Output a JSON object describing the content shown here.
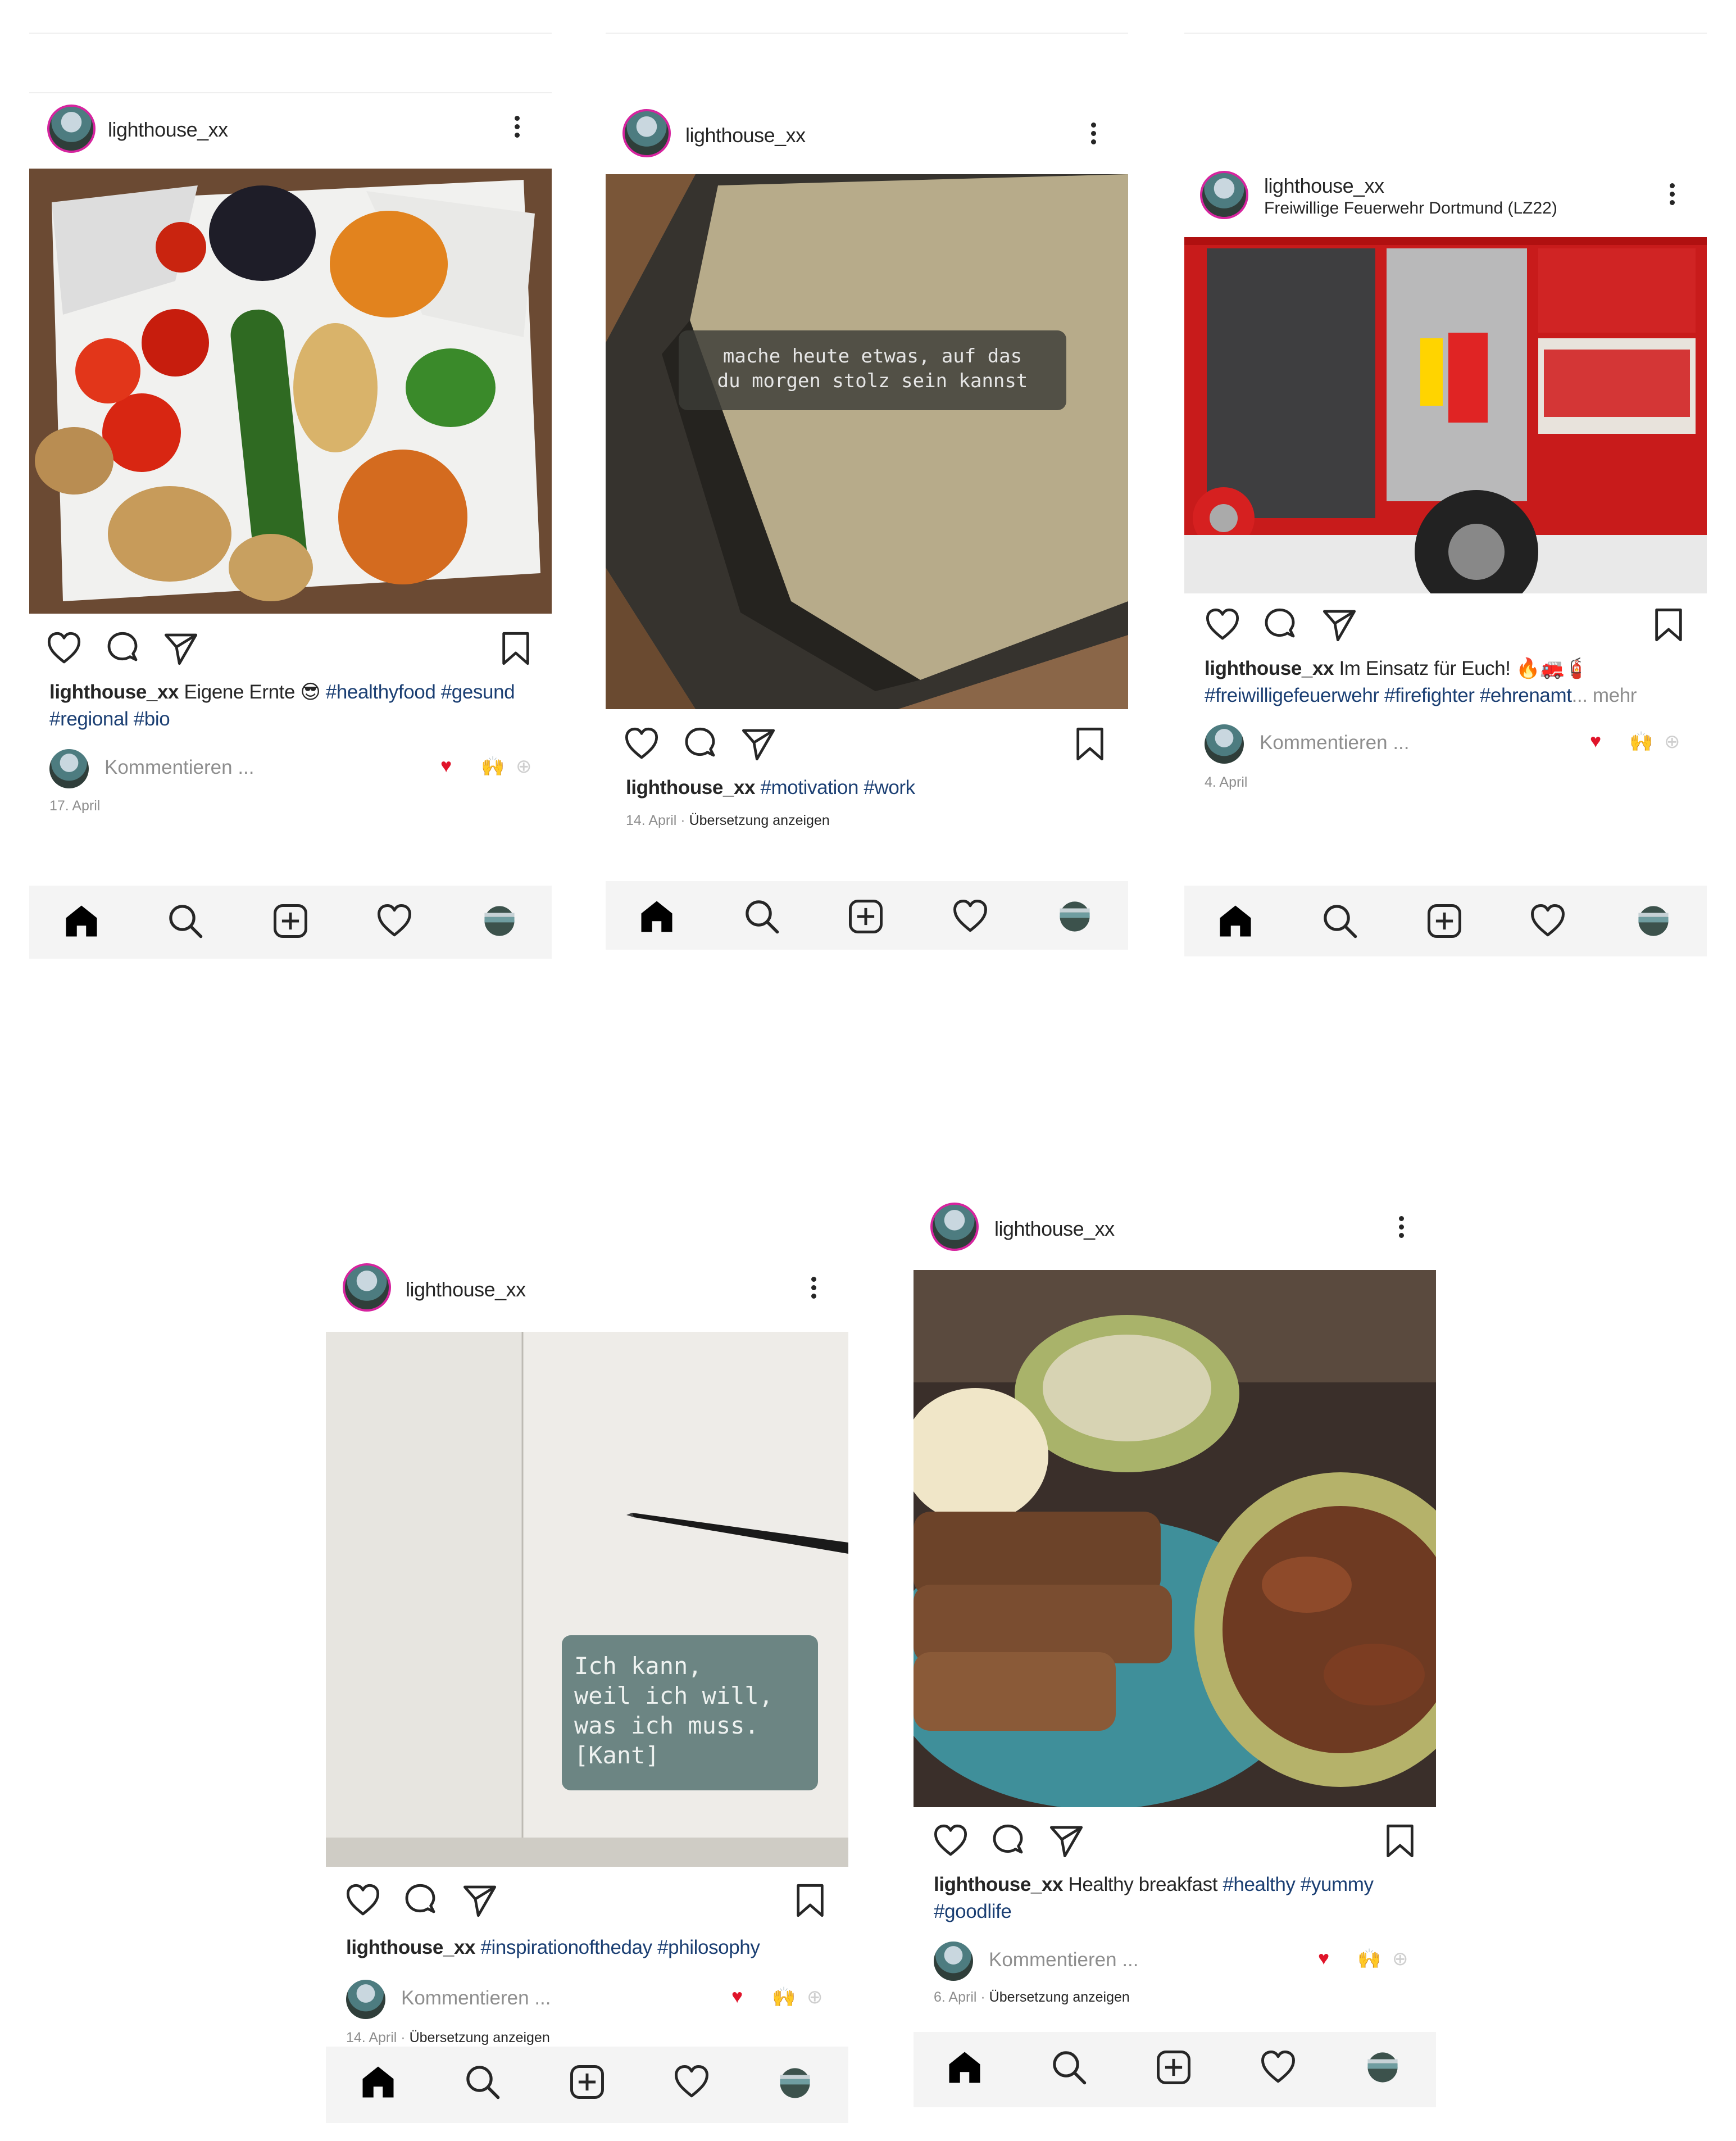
{
  "posts": [
    {
      "username": "lighthouse_xx",
      "location": "",
      "caption_user": "lighthouse_xx",
      "caption_text": " Eigene Ernte 😎 ",
      "tags_line1": "#healthyfood #gesund",
      "tags_line2": "#regional #bio",
      "comment_placeholder": "Kommentieren ...",
      "date": "17. April",
      "translation": ""
    },
    {
      "username": "lighthouse_xx",
      "location": "",
      "caption_user": "lighthouse_xx",
      "caption_text": " ",
      "tags_line1": "#motivation #work",
      "quote": "mache heute etwas, auf das\ndu morgen stolz sein kannst",
      "date": "14. April · ",
      "translation": "Übersetzung anzeigen"
    },
    {
      "username": "lighthouse_xx",
      "location": "Freiwillige Feuerwehr Dortmund (LZ22)",
      "caption_user": "lighthouse_xx",
      "caption_text": " Im Einsatz für Euch! 🔥🚒🧯",
      "tags_line2": "#freiwilligefeuerwehr #firefighter #ehrenamt",
      "more": "... mehr",
      "comment_placeholder": "Kommentieren ...",
      "date": "4. April",
      "translation": ""
    },
    {
      "username": "lighthouse_xx",
      "location": "",
      "caption_user": "lighthouse_xx",
      "caption_text": " ",
      "tags_line1": "#inspirationoftheday #philosophy",
      "quote": "Ich kann,\nweil ich will,\nwas ich muss.\n[Kant]",
      "comment_placeholder": "Kommentieren ...",
      "date": "14. April · ",
      "translation": "Übersetzung anzeigen"
    },
    {
      "username": "lighthouse_xx",
      "location": "",
      "caption_user": "lighthouse_xx",
      "caption_text": " Healthy breakfast ",
      "tags_line1": "#healthy #yummy",
      "tags_line2": "#goodlife",
      "comment_placeholder": "Kommentieren ...",
      "date": "6. April · ",
      "translation": "Übersetzung anzeigen"
    }
  ],
  "reactions": {
    "heart": "♥",
    "clap": "🙌",
    "add": "⊕"
  },
  "icons": [
    "home-icon",
    "search-icon",
    "add-post-icon",
    "activity-heart-icon",
    "profile-avatar-icon",
    "like-icon",
    "comment-icon",
    "share-icon",
    "bookmark-icon",
    "more-options-icon"
  ],
  "colors": {
    "heart_red": "#e0142a",
    "tag_blue": "#1b3f73",
    "muted_gray": "#8e8e8e",
    "nav_bg": "#f4f4f4"
  }
}
